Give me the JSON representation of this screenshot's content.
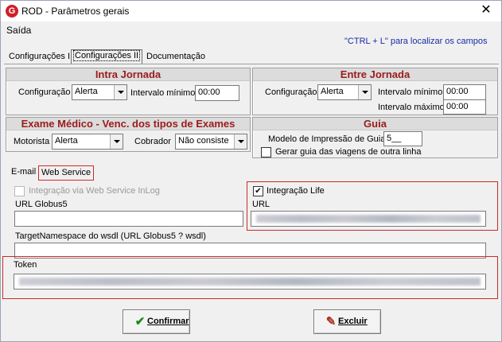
{
  "window": {
    "icon_letter": "G",
    "title": "ROD - Parâmetros gerais",
    "close_glyph": "✕"
  },
  "menu": {
    "exit_label": "Saída"
  },
  "hint": "\"CTRL + L\" para localizar os campos",
  "tabs": [
    {
      "label": "Configurações I",
      "active": false
    },
    {
      "label": "Configurações II",
      "active": true
    },
    {
      "label": "Documentação",
      "active": false
    }
  ],
  "intra_jornada": {
    "title": "Intra Jornada",
    "config_label": "Configuração",
    "config_value": "Alerta",
    "min_interval_label": "Intervalo mínimo",
    "min_interval_value": "00:00"
  },
  "entre_jornada": {
    "title": "Entre Jornada",
    "config_label": "Configuração",
    "config_value": "Alerta",
    "min_interval_label": "Intervalo mínimo",
    "min_interval_value": "00:00",
    "max_interval_label": "Intervalo máximo",
    "max_interval_value": "00:00"
  },
  "exame_medico": {
    "title": "Exame Médico - Venc. dos tipos de Exames",
    "driver_label": "Motorista",
    "driver_value": "Alerta",
    "collector_label": "Cobrador",
    "collector_value": "Não consiste"
  },
  "guia": {
    "title": "Guia",
    "print_model_label": "Modelo de Impressão de Guia",
    "print_model_value": "5__",
    "generate_label": "Gerar guia das viagens de outra linha",
    "generate_checked": false
  },
  "subtabs": [
    {
      "label": "E-mail",
      "active": false
    },
    {
      "label": "Web Service",
      "active": true
    }
  ],
  "web_service": {
    "inlog_label": "Integração via Web Service InLog",
    "inlog_checked": false,
    "life_label": "Integração Life",
    "life_checked": true,
    "url_globus_label": "URL Globus5",
    "url_globus_value": "",
    "url_label": "URL",
    "target_ns_label": "TargetNamespace do wsdl (URL Globus5 ? wsdl)",
    "target_ns_value": "",
    "token_label": "Token"
  },
  "buttons": {
    "confirm_label": "Confirmar",
    "confirm_icon": "✔",
    "delete_label": "Excluir",
    "delete_icon": "✎"
  },
  "colors": {
    "section_title": "#9b1b1b",
    "highlight_border": "#cc2a2a",
    "hint_text": "#1a2aa8",
    "app_icon": "#d21f26"
  }
}
